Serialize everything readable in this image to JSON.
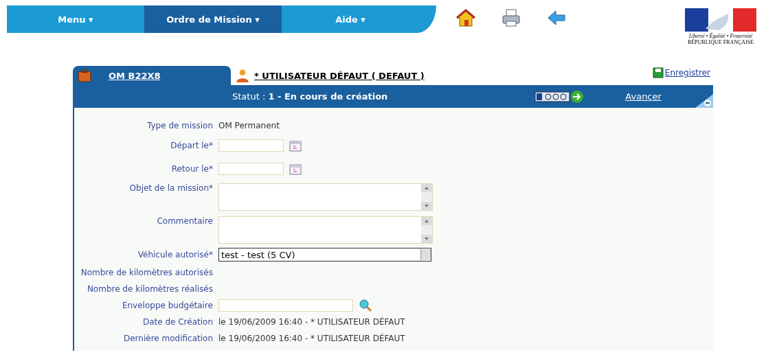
{
  "nav": {
    "items": [
      {
        "label": "Menu ▾",
        "selected": false
      },
      {
        "label": "Ordre de Mission ▾",
        "selected": true
      },
      {
        "label": "Aide ▾",
        "selected": false
      }
    ]
  },
  "logo": {
    "motto": "Liberté • Égalité • Fraternité",
    "name": "RÉPUBLIQUE FRANÇAISE"
  },
  "tabs": [
    {
      "label": "OM B22X8",
      "selected": true,
      "kind": "mission"
    },
    {
      "label": "* UTILISATEUR DÉFAUT ( DEFAUT )",
      "selected": false,
      "kind": "user"
    }
  ],
  "save_link": "Enregistrer",
  "status": {
    "label": "Statut :",
    "value": "1 - En cours de création",
    "advance": "Avancer"
  },
  "fields": [
    {
      "label": "Type de mission",
      "kind": "text",
      "value": "OM Permanent"
    },
    {
      "label": "Départ le*",
      "kind": "date"
    },
    {
      "label": "Retour le*",
      "kind": "date"
    },
    {
      "label": "Objet de la mission*",
      "kind": "textarea"
    },
    {
      "label": "Commentaire",
      "kind": "textarea"
    },
    {
      "label": "Véhicule autorisé*",
      "kind": "select",
      "value": "test - test (5 CV)"
    },
    {
      "label": "Nombre de kilomètres autorisés",
      "kind": "empty"
    },
    {
      "label": "Nombre de kilomètres réalisés",
      "kind": "empty"
    },
    {
      "label": "Enveloppe budgétaire",
      "kind": "lookup"
    },
    {
      "label": "Date de Création",
      "kind": "text",
      "value": "le 19/06/2009 16:40 - * UTILISATEUR DÉFAUT"
    },
    {
      "label": "Dernière modification",
      "kind": "text",
      "value": "le 19/06/2009 16:40 - * UTILISATEUR DÉFAUT"
    }
  ]
}
